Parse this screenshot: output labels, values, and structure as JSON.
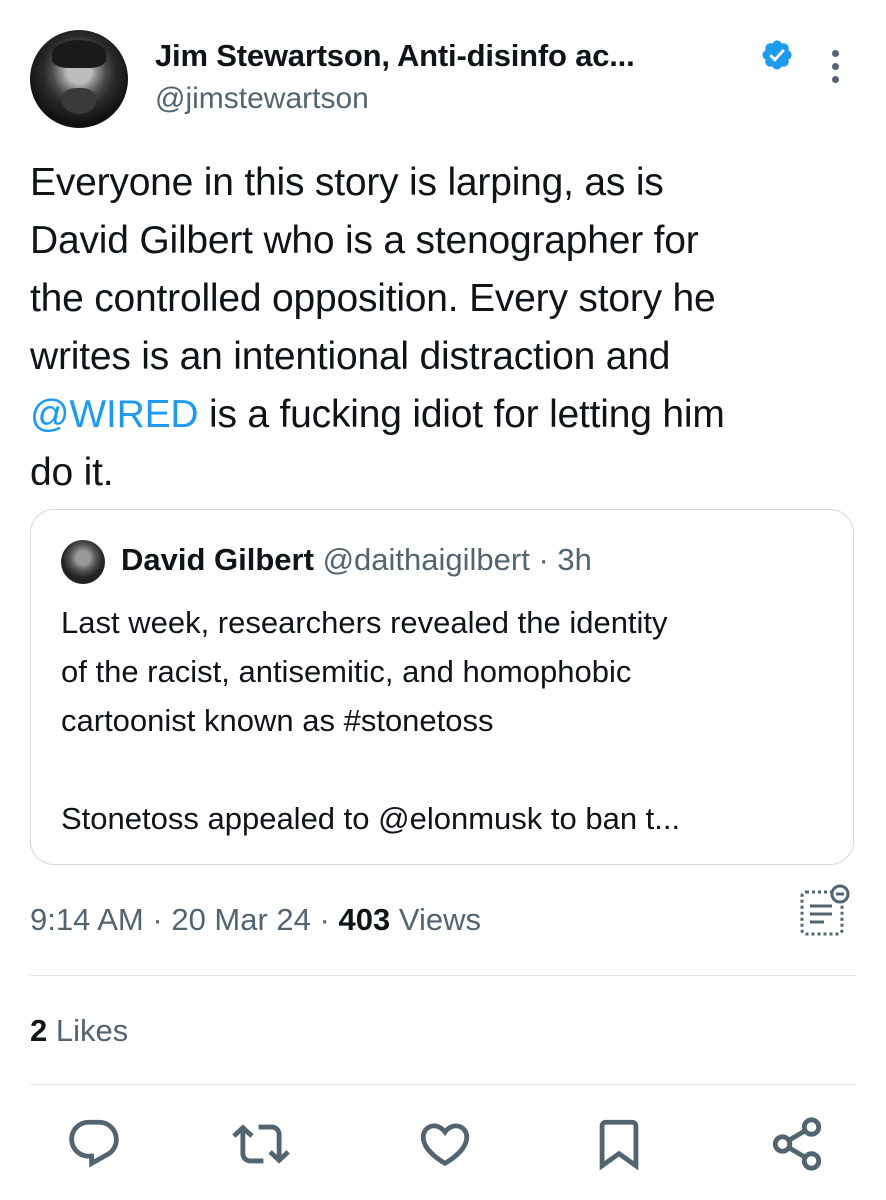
{
  "tweet": {
    "author_name": "Jim Stewartson, Anti-disinfo ac...",
    "author_handle": "@jimstewartson",
    "text_before": "Everyone in this story is larping, as is\nDavid Gilbert who is a stenographer for\nthe controlled opposition. Every story he\nwrites is an intentional distraction and\n",
    "mention": "@WIRED",
    "text_after": " is a fucking idiot for letting him\ndo it.",
    "time": "9:14 AM",
    "date": "20 Mar 24",
    "views_count": "403",
    "views_label": "Views",
    "likes_count": "2",
    "likes_label": "Likes"
  },
  "quote": {
    "name": "David Gilbert",
    "handle": "@daithaigilbert",
    "age": "3h",
    "body": "Last week, researchers revealed the identity\nof the racist, antisemitic, and homophobic\ncartoonist known as #stonetoss\n\nStonetoss appealed to @elonmusk to ban t..."
  },
  "icons": {
    "verified": "verified-badge-icon",
    "more": "more-options-icon",
    "analytics": "analytics-icon",
    "reply": "reply-icon",
    "retweet": "retweet-icon",
    "like": "like-icon",
    "bookmark": "bookmark-icon",
    "share": "share-icon"
  },
  "colors": {
    "accent": "#1d9bf0",
    "secondary_text": "#536471",
    "primary_text": "#0f1419"
  }
}
